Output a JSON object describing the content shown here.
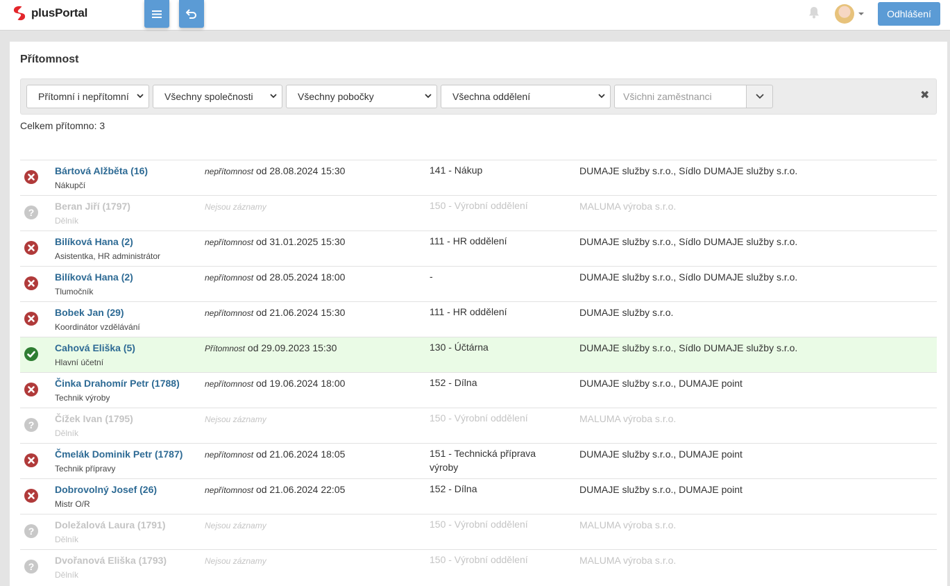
{
  "app": {
    "name": "plusPortal",
    "logout_label": "Odhlášení"
  },
  "page": {
    "title": "Přítomnost"
  },
  "filters": {
    "presence": "Přítomní i nepřítomní",
    "company": "Všechny společnosti",
    "branch": "Všechny pobočky",
    "department": "Všechna oddělení",
    "employee_placeholder": "Všichni zaměstnanci"
  },
  "summary": {
    "total_present": "Celkem přítomno: 3"
  },
  "colors": {
    "accent": "#5b9bd5",
    "absent": "#b03a3a",
    "present": "#2e7d32",
    "unknown": "#c8c8c8",
    "present_row": "#eafbe6",
    "link": "#2d6a94"
  },
  "employees": [
    {
      "status": "absent",
      "name": "Bártová Alžběta (16)",
      "position": "Nákupčí",
      "event_type": "nepřítomnost",
      "event_time": "od 28.08.2024 15:30",
      "department": "141 - Nákup",
      "company": "DUMAJE služby s.r.o., Sídlo DUMAJE služby s.r.o."
    },
    {
      "status": "unknown",
      "name": "Beran Jiří (1797)",
      "position": "Dělník",
      "event_type": "Nejsou záznamy",
      "event_time": "",
      "department": "150 - Výrobní oddělení",
      "company": "MALUMA výroba s.r.o."
    },
    {
      "status": "absent",
      "name": "Bilíková Hana (2)",
      "position": "Asistentka, HR administrátor",
      "event_type": "nepřítomnost",
      "event_time": "od 31.01.2025 15:30",
      "department": "111 - HR oddělení",
      "company": "DUMAJE služby s.r.o., Sídlo DUMAJE služby s.r.o."
    },
    {
      "status": "absent",
      "name": "Bilíková Hana (2)",
      "position": "Tlumočník",
      "event_type": "nepřítomnost",
      "event_time": "od 28.05.2024 18:00",
      "department": " -",
      "company": "DUMAJE služby s.r.o., Sídlo DUMAJE služby s.r.o."
    },
    {
      "status": "absent",
      "name": "Bobek Jan (29)",
      "position": "Koordinátor vzdělávání",
      "event_type": "nepřítomnost",
      "event_time": "od 21.06.2024 15:30",
      "department": "111 - HR oddělení",
      "company": "DUMAJE služby s.r.o."
    },
    {
      "status": "present",
      "name": "Cahová Eliška (5)",
      "position": "Hlavní účetní",
      "event_type": "Přítomnost",
      "event_time": "od 29.09.2023 15:30",
      "department": "130 - Účtárna",
      "company": "DUMAJE služby s.r.o., Sídlo DUMAJE služby s.r.o."
    },
    {
      "status": "absent",
      "name": "Činka Drahomír Petr (1788)",
      "position": "Technik výroby",
      "event_type": "nepřítomnost",
      "event_time": "od 19.06.2024 18:00",
      "department": "152 - Dílna",
      "company": "DUMAJE služby s.r.o., DUMAJE point"
    },
    {
      "status": "unknown",
      "name": "Čížek Ivan (1795)",
      "position": "Dělník",
      "event_type": "Nejsou záznamy",
      "event_time": "",
      "department": "150 - Výrobní oddělení",
      "company": "MALUMA výroba s.r.o."
    },
    {
      "status": "absent",
      "name": "Čmelák Dominik Petr (1787)",
      "position": "Technik přípravy",
      "event_type": "nepřítomnost",
      "event_time": "od 21.06.2024 18:05",
      "department": "151 - Technická příprava výroby",
      "company": "DUMAJE služby s.r.o., DUMAJE point"
    },
    {
      "status": "absent",
      "name": "Dobrovolný Josef (26)",
      "position": "Mistr O/R",
      "event_type": "nepřítomnost",
      "event_time": "od 21.06.2024 22:05",
      "department": "152 - Dílna",
      "company": "DUMAJE služby s.r.o., DUMAJE point"
    },
    {
      "status": "unknown",
      "name": "Doležalová Laura (1791)",
      "position": "Dělník",
      "event_type": "Nejsou záznamy",
      "event_time": "",
      "department": "150 - Výrobní oddělení",
      "company": "MALUMA výroba s.r.o."
    },
    {
      "status": "unknown",
      "name": "Dvořanová Eliška (1793)",
      "position": "Dělník",
      "event_type": "Nejsou záznamy",
      "event_time": "",
      "department": "150 - Výrobní oddělení",
      "company": "MALUMA výroba s.r.o."
    }
  ]
}
